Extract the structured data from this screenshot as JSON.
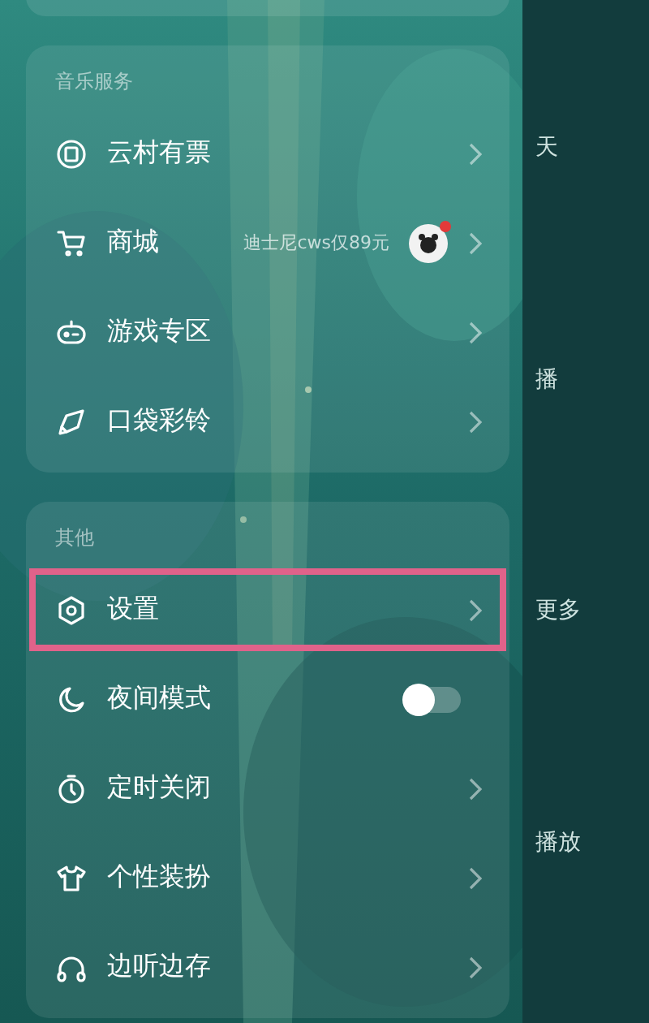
{
  "sections": [
    {
      "title": "音乐服务",
      "items": [
        {
          "kind": "link",
          "label": "云村有票"
        },
        {
          "kind": "promo",
          "label": "商城",
          "note": "迪士尼cws仅89元",
          "badge_dot": true
        },
        {
          "kind": "link",
          "label": "游戏专区"
        },
        {
          "kind": "link",
          "label": "口袋彩铃"
        }
      ]
    },
    {
      "title": "其他",
      "items": [
        {
          "kind": "link",
          "label": "设置",
          "highlighted": true
        },
        {
          "kind": "toggle",
          "label": "夜间模式",
          "on": false
        },
        {
          "kind": "link",
          "label": "定时关闭"
        },
        {
          "kind": "link",
          "label": "个性装扮"
        },
        {
          "kind": "link",
          "label": "边听边存"
        }
      ]
    }
  ],
  "background_page": {
    "texts": [
      "天",
      "播",
      "更多",
      "播放"
    ]
  }
}
